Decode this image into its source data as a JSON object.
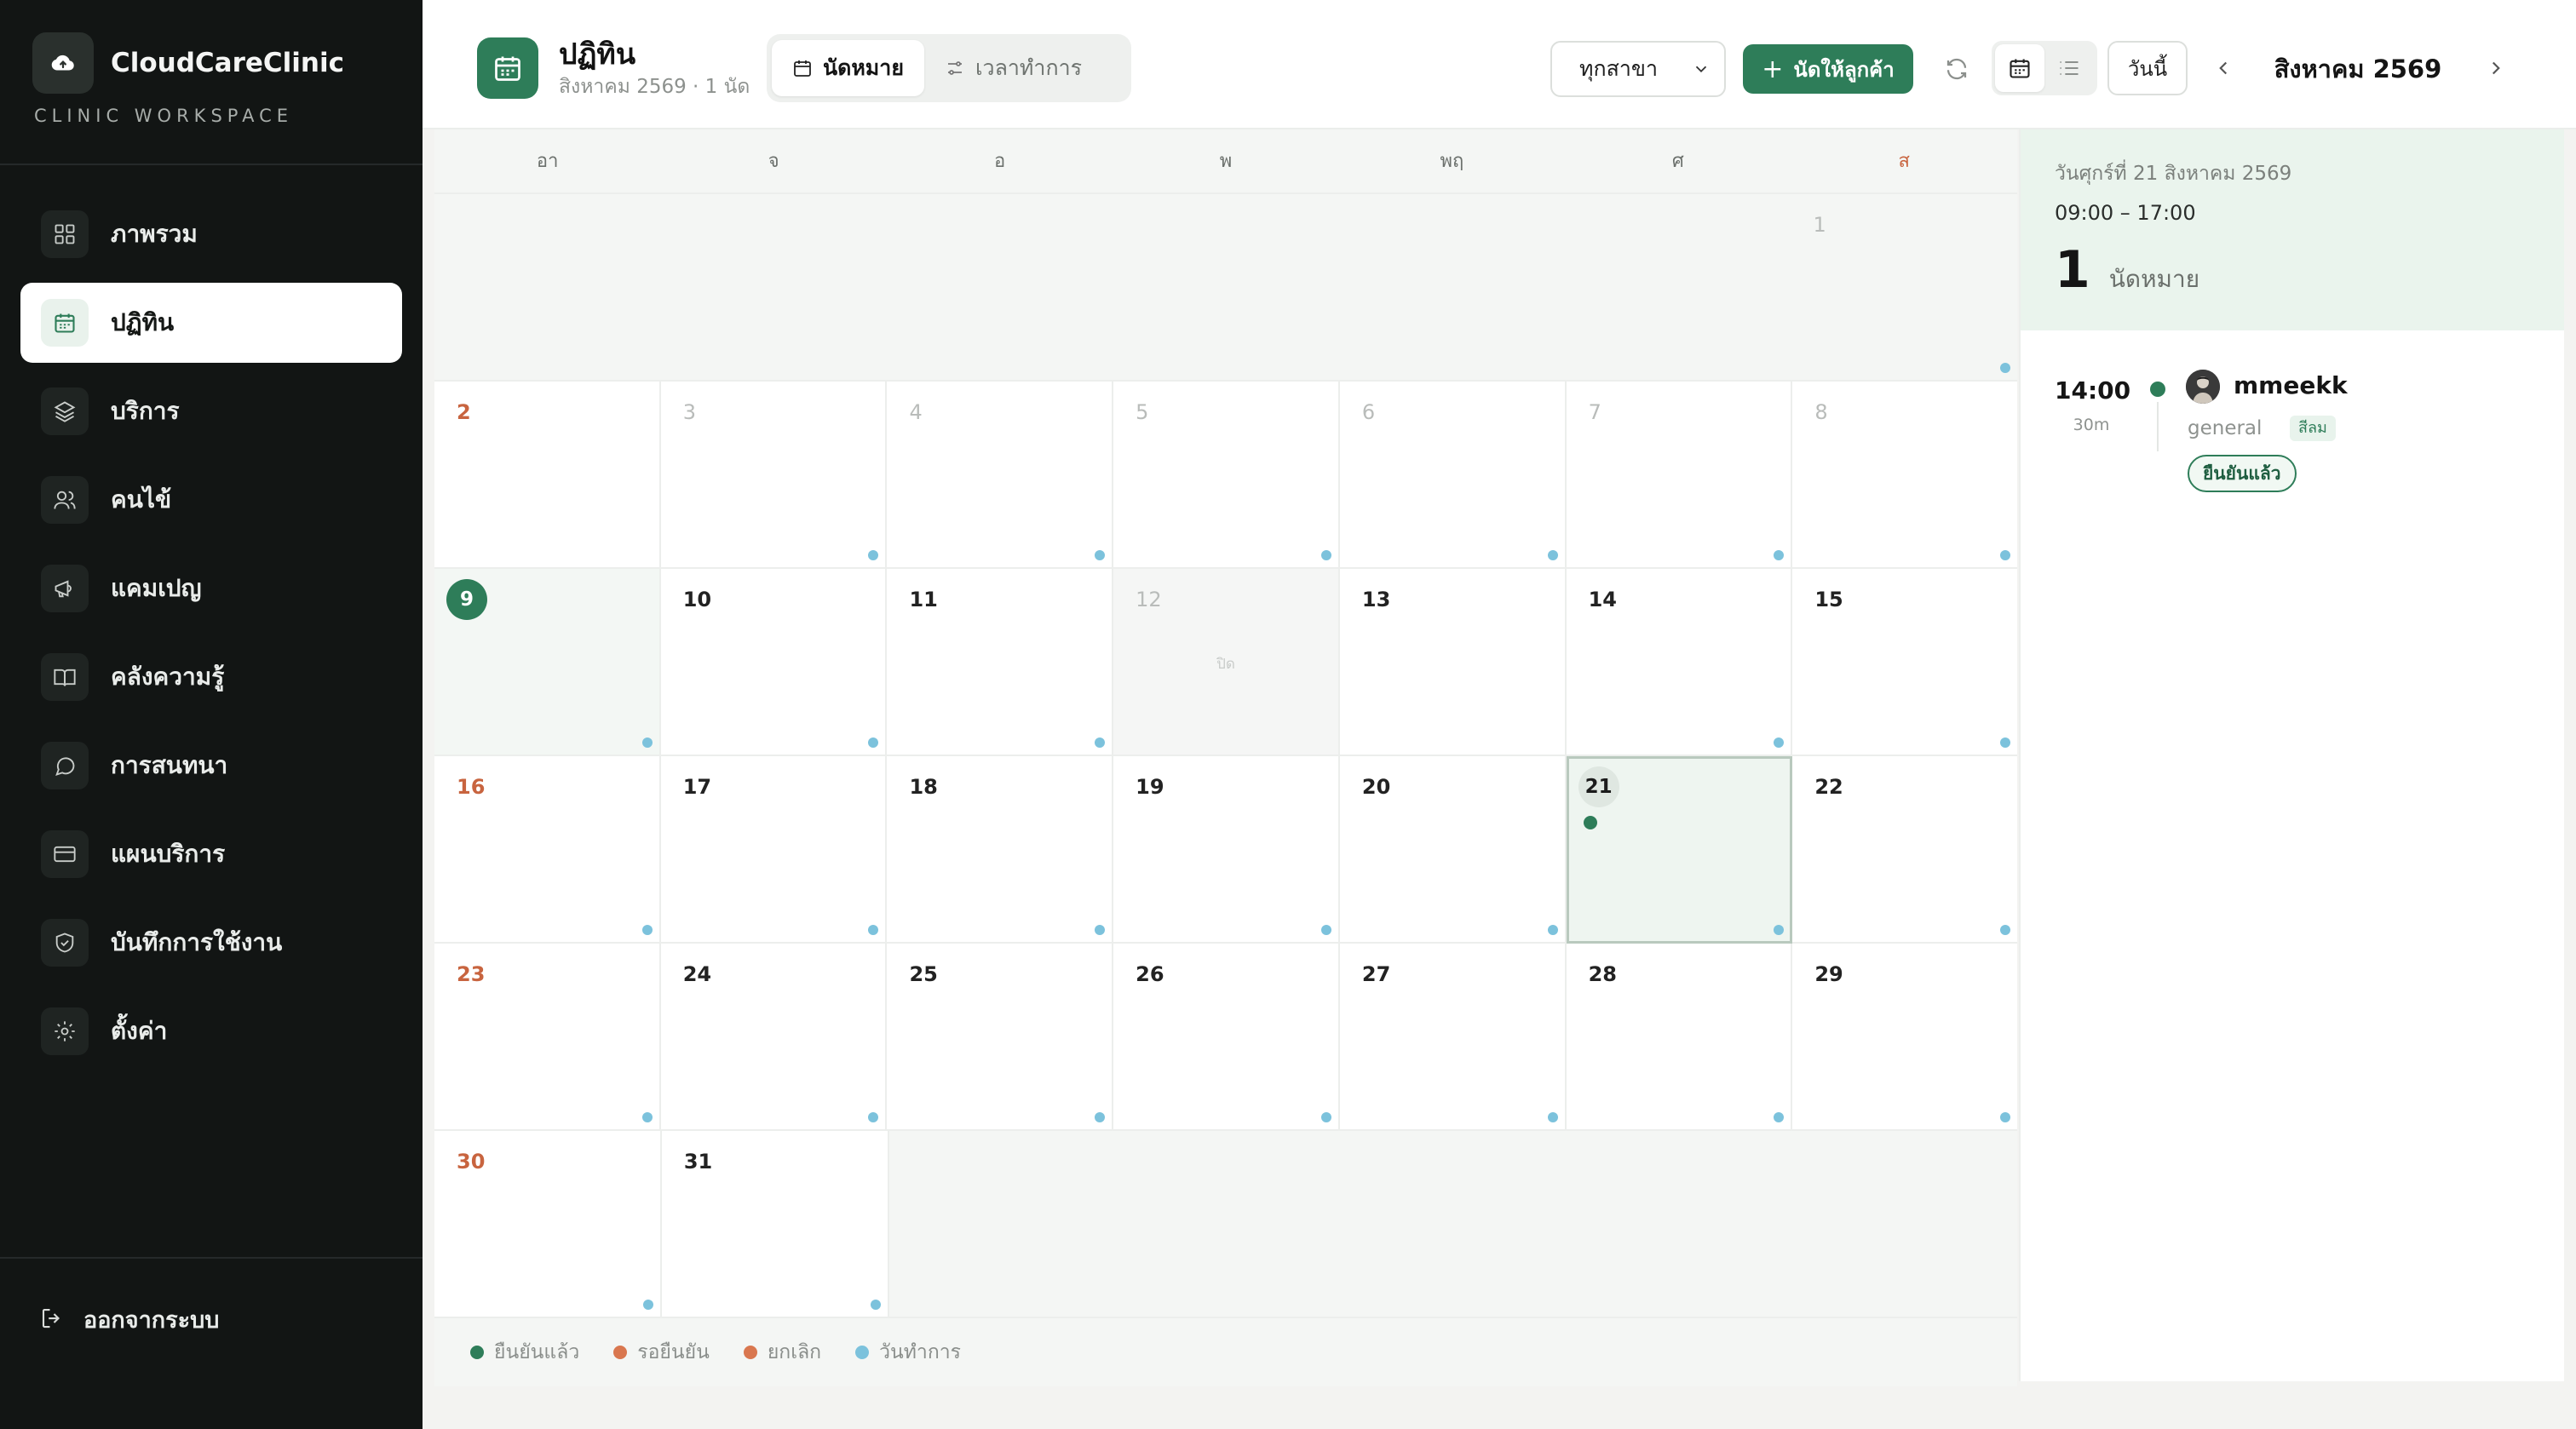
{
  "brand": {
    "name": "CloudCareClinic",
    "sub": "CLINIC WORKSPACE"
  },
  "sidebar": {
    "items": [
      {
        "label": "ภาพรวม",
        "icon": "grid-icon"
      },
      {
        "label": "ปฏิทิน",
        "icon": "calendar-icon",
        "active": true
      },
      {
        "label": "บริการ",
        "icon": "layers-icon"
      },
      {
        "label": "คนไข้",
        "icon": "users-icon"
      },
      {
        "label": "แคมเปญ",
        "icon": "megaphone-icon"
      },
      {
        "label": "คลังความรู้",
        "icon": "book-icon"
      },
      {
        "label": "การสนทนา",
        "icon": "chat-icon"
      },
      {
        "label": "แผนบริการ",
        "icon": "card-icon"
      },
      {
        "label": "บันทึกการใช้งาน",
        "icon": "shield-icon"
      },
      {
        "label": "ตั้งค่า",
        "icon": "gear-icon"
      }
    ],
    "logout": "ออกจากระบบ"
  },
  "header": {
    "title": "ปฏิทิน",
    "subtitle": "สิงหาคม 2569 · 1 นัด",
    "tabs": [
      "นัดหมาย",
      "เวลาทำการ"
    ],
    "branch": "ทุกสาขา",
    "book_button": "นัดให้ลูกค้า",
    "today_button": "วันนี้",
    "month": "สิงหาคม 2569"
  },
  "calendar": {
    "weekdays": [
      "อา",
      "จ",
      "อ",
      "พ",
      "พฤ",
      "ศ",
      "ส"
    ],
    "closed_label": "ปิด",
    "today": 9,
    "selected": 21
  },
  "legend": [
    {
      "label": "ยืนยันแล้ว",
      "color": "#2e7d59"
    },
    {
      "label": "รอยืนยัน",
      "color": "#d9774f"
    },
    {
      "label": "ยกเลิก",
      "color": "#d9774f"
    },
    {
      "label": "วันทำการ",
      "color": "#7cc2dc"
    }
  ],
  "panel": {
    "date": "วันศุกร์ที่ 21 สิงหาคม 2569",
    "hours": "09:00 – 17:00",
    "count": "1",
    "count_label": "นัดหมาย",
    "appointment": {
      "time": "14:00",
      "duration": "30m",
      "name": "mmeekk",
      "service": "general",
      "branch_tag": "สีลม",
      "status": "ยืนยันแล้ว"
    }
  },
  "colors": {
    "accent": "#2e7d59",
    "sidebar_bg": "#121514",
    "sunday": "#c8643f",
    "workday_dot": "#7cc2dc"
  }
}
